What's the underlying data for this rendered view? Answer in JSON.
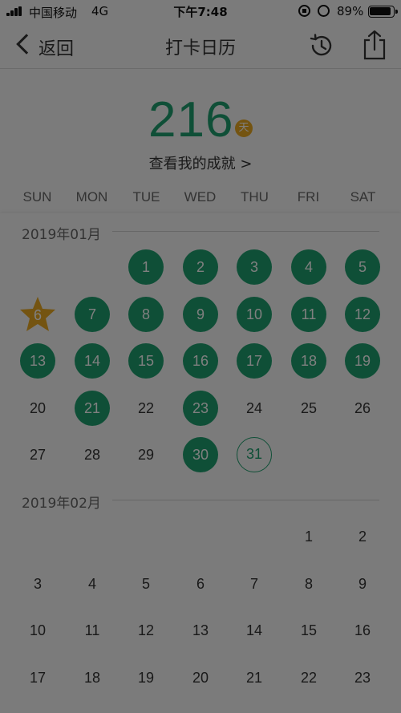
{
  "status_bar": {
    "carrier": "中国移动",
    "network": "4G",
    "time": "下午7:48",
    "battery": "89%"
  },
  "nav": {
    "back_label": "返回",
    "title": "打卡日历",
    "history_icon": "history-icon",
    "share_icon": "share-icon"
  },
  "summary": {
    "total_days": "216",
    "unit": "天",
    "achievements_link": "查看我的成就 >"
  },
  "weekdays": [
    "SUN",
    "MON",
    "TUE",
    "WED",
    "THU",
    "FRI",
    "SAT"
  ],
  "colors": {
    "accent_green": "#1f9f6e",
    "badge_orange": "#e9a922"
  },
  "months": [
    {
      "label": "2019年01月",
      "first_weekday": 2,
      "days": [
        "1",
        "2",
        "3",
        "4",
        "5",
        "6",
        "7",
        "8",
        "9",
        "10",
        "11",
        "12",
        "13",
        "14",
        "15",
        "16",
        "17",
        "18",
        "19",
        "20",
        "21",
        "22",
        "23",
        "24",
        "25",
        "26",
        "27",
        "28",
        "29",
        "30",
        "31"
      ],
      "checked": [
        "1",
        "2",
        "3",
        "4",
        "5",
        "7",
        "8",
        "9",
        "10",
        "11",
        "12",
        "13",
        "14",
        "15",
        "16",
        "17",
        "18",
        "19",
        "21",
        "23",
        "30"
      ],
      "star": "6",
      "today": "31"
    },
    {
      "label": "2019年02月",
      "first_weekday": 5,
      "days": [
        "1",
        "2",
        "3",
        "4",
        "5",
        "6",
        "7",
        "8",
        "9",
        "10",
        "11",
        "12",
        "13",
        "14",
        "15",
        "16",
        "17",
        "18",
        "19",
        "20",
        "21",
        "22",
        "23"
      ],
      "checked": [],
      "star": null,
      "today": null
    }
  ]
}
